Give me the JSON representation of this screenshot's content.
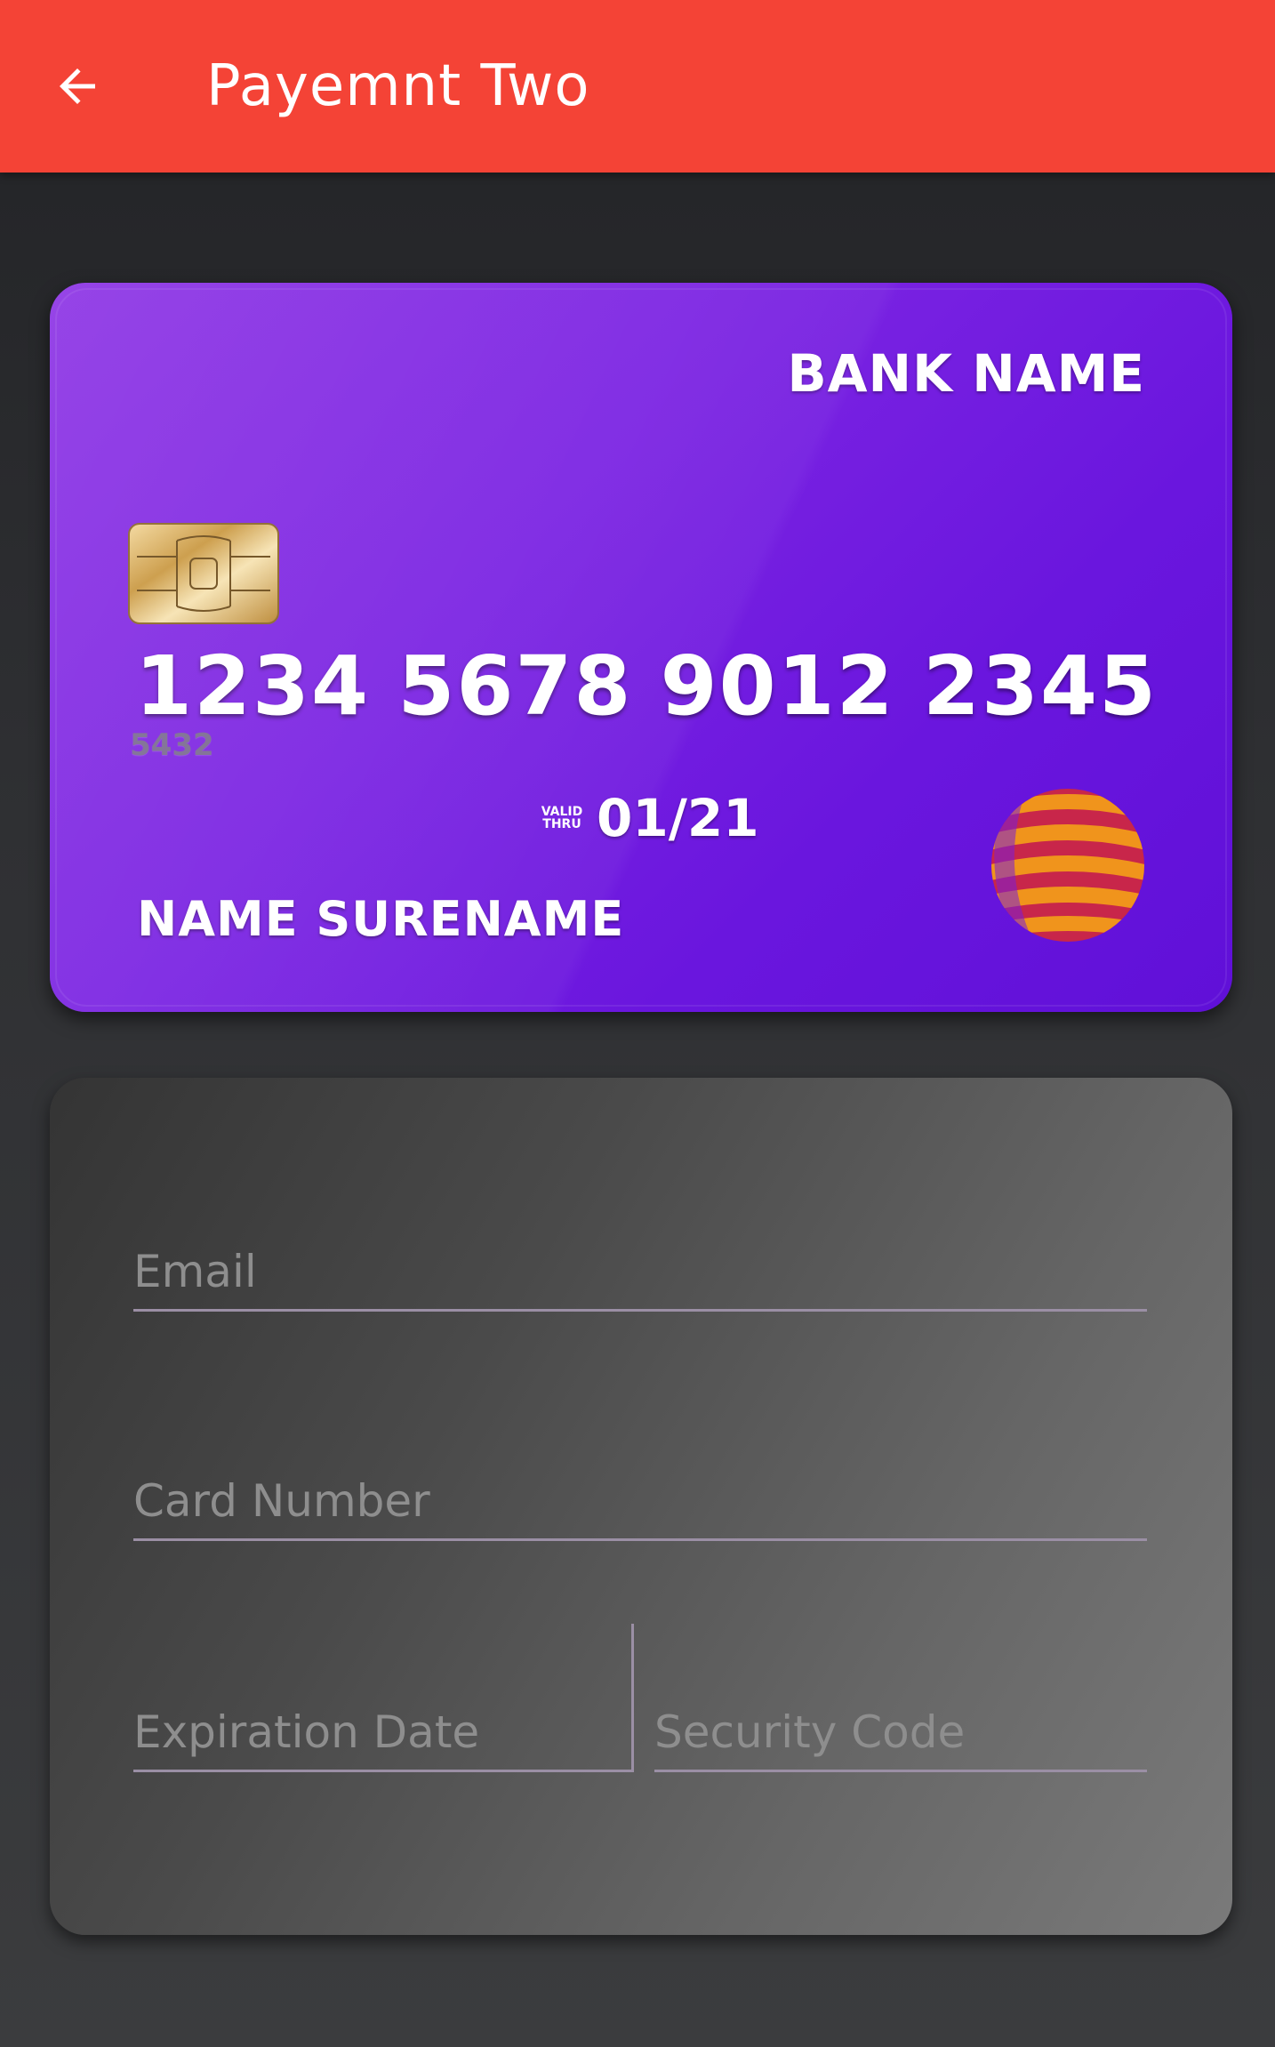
{
  "appbar": {
    "title": "Payemnt Two",
    "back_icon": "arrow-left-icon",
    "color": "#f44336"
  },
  "card": {
    "bank_name": "BANK NAME",
    "number_groups": [
      "1234",
      "5678",
      "9012",
      "2345"
    ],
    "small_digits": "5432",
    "valid_label_line1": "VALID",
    "valid_label_line2": "THRU",
    "expiry": "01/21",
    "holder_name": "NAME SURENAME",
    "chip_icon": "chip-icon",
    "logo_icon": "globe-logo-icon",
    "color": "#7a23e2"
  },
  "form": {
    "email_placeholder": "Email",
    "card_number_placeholder": "Card Number",
    "expiration_placeholder": "Expiration Date",
    "security_placeholder": "Security Code"
  }
}
